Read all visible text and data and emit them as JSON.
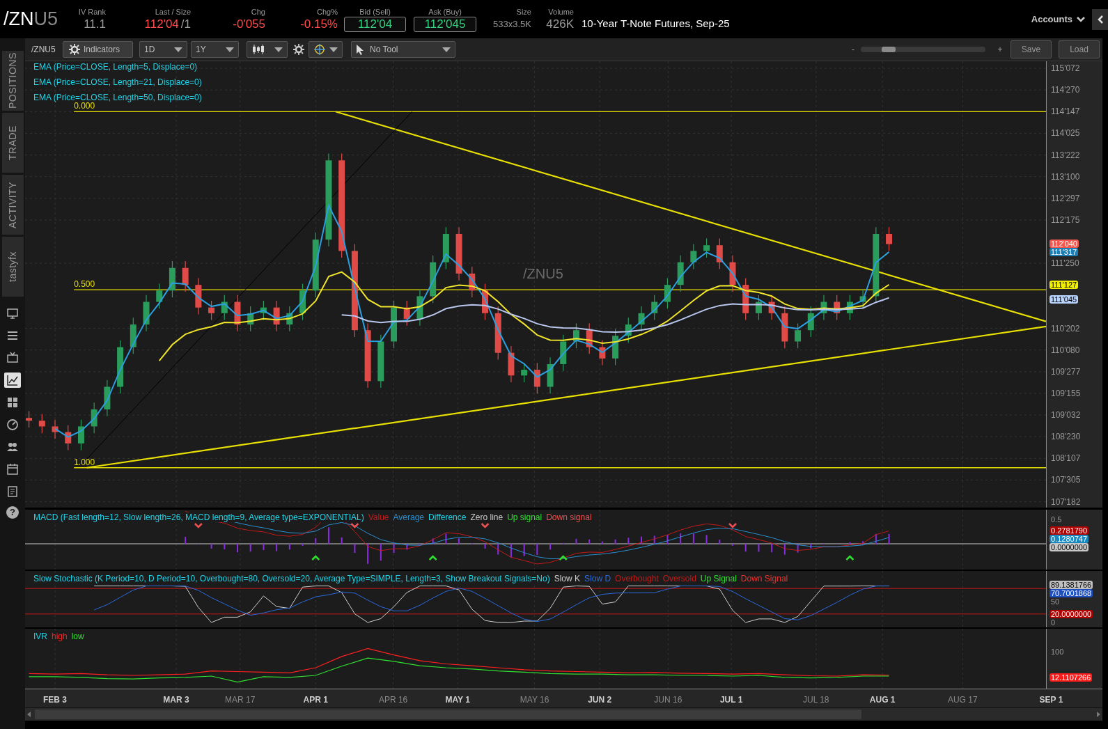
{
  "header": {
    "symbol_root": "/ZN",
    "symbol_month": "U5",
    "description": "10-Year T-Note Futures, Sep-25",
    "accounts": "Accounts"
  },
  "quote": [
    {
      "label": "IV Rank",
      "value": "11.1",
      "color": "#9a9a9a",
      "boxed": false
    },
    {
      "label": "Last / Size",
      "value": "112'04",
      "size": "/1",
      "color": "#ff4a4a",
      "boxed": false
    },
    {
      "label": "Chg",
      "value": "-0'055",
      "color": "#ff4a4a",
      "boxed": false
    },
    {
      "label": "Chg%",
      "value": "-0.15%",
      "color": "#ff4a4a",
      "boxed": false
    },
    {
      "label": "Bid (Sell)",
      "value": "112'04",
      "color": "#35d07f",
      "boxed": true
    },
    {
      "label": "Ask (Buy)",
      "value": "112'045",
      "color": "#35d07f",
      "boxed": true
    },
    {
      "label": "Size",
      "value": "533x3.5K",
      "color": "#9a9a9a",
      "boxed": false
    },
    {
      "label": "Volume",
      "value": "426K",
      "color": "#9a9a9a",
      "boxed": false
    }
  ],
  "toolbar": {
    "symbol": "/ZNU5",
    "indicators": "Indicators",
    "aggregation": "1D",
    "period": "1Y",
    "tool": "No Tool",
    "zoom_slider": {
      "level": 0.19
    },
    "zoom_out": "-",
    "zoom_in": "+",
    "save": "Save",
    "load": "Load"
  },
  "sidebar": {
    "tabs": [
      "POSITIONS",
      "TRADE",
      "ACTIVITY",
      "tastyfx"
    ],
    "tools": [
      {
        "selected": false
      },
      {
        "selected": false
      },
      {
        "selected": false
      },
      {
        "selected": true
      },
      {
        "selected": false
      },
      {
        "selected": false
      },
      {
        "selected": false
      },
      {
        "selected": false
      },
      {
        "selected": false
      }
    ],
    "help": "?"
  },
  "price_chart": {
    "watermark": "/ZNU5",
    "legend": [
      {
        "text": "EMA (Price=CLOSE, Length=5, Displace=0)",
        "color": "#22d3e6"
      },
      {
        "text": "EMA (Price=CLOSE, Length=21, Displace=0)",
        "color": "#22d3e6"
      },
      {
        "text": "EMA (Price=CLOSE, Length=50, Displace=0)",
        "color": "#22d3e6"
      }
    ],
    "fib_labels": [
      "0.000",
      "0.500",
      "1.000"
    ],
    "axis_labels": [
      "115'072",
      "114'270",
      "114'147",
      "114'025",
      "113'222",
      "113'100",
      "112'297",
      "112'175",
      "111'250",
      "110'202",
      "110'080",
      "109'277",
      "109'155",
      "109'032",
      "108'230",
      "108'107",
      "107'305",
      "107'182"
    ],
    "price_tags": [
      {
        "label": "112'040",
        "color": "#f0584f"
      },
      {
        "label": "111'317",
        "color": "#1a7fb5"
      },
      {
        "label": "111'127",
        "color": "#f2ee00"
      },
      {
        "label": "111'045",
        "color": "#b9d3ff"
      }
    ]
  },
  "macd": {
    "legend": [
      {
        "text": "MACD (Fast length=12, Slow length=26, MACD length=9, Average type=EXPONENTIAL)",
        "color": "#22d3e6"
      },
      {
        "text": "Value",
        "color": "#c41a1a"
      },
      {
        "text": "Average",
        "color": "#2a8fd0"
      },
      {
        "text": "Difference",
        "color": "#22d3e6"
      },
      {
        "text": "Zero line",
        "color": "#c8c8c8"
      },
      {
        "text": "Up signal",
        "color": "#2ee02e"
      },
      {
        "text": "Down signal",
        "color": "#f05050"
      }
    ],
    "ticks": [
      "0.5"
    ],
    "tags": [
      {
        "label": "0.2781790",
        "color": "#b00000"
      },
      {
        "label": "0.1280747",
        "color": "#1a88c0"
      },
      {
        "label": "0.0000000",
        "color": "#c8c8c8"
      }
    ]
  },
  "stochastic": {
    "legend": [
      {
        "text": "Slow Stochastic (K Period=10, D Period=10, Overbought=80, Oversold=20, Average Type=SIMPLE, Length=3, Show Breakout Signals=No)",
        "color": "#22d3e6"
      },
      {
        "text": "Slow K",
        "color": "#d0d0d0"
      },
      {
        "text": "Slow D",
        "color": "#2a6ae0"
      },
      {
        "text": "Overbought",
        "color": "#c41a1a"
      },
      {
        "text": "Oversold",
        "color": "#c41a1a"
      },
      {
        "text": "Up Signal",
        "color": "#2ee02e"
      },
      {
        "text": "Down Signal",
        "color": "#f03030"
      }
    ],
    "ticks": [
      "50",
      "0"
    ],
    "tags": [
      {
        "label": "89.1381766",
        "color": "#c0c0c0"
      },
      {
        "label": "70.7001868",
        "color": "#1e4fc0"
      },
      {
        "label": "20.0000000",
        "color": "#b00000"
      }
    ]
  },
  "ivr": {
    "legend": [
      {
        "text": "IVR",
        "color": "#22d3e6"
      },
      {
        "text": "high",
        "color": "#ff2020"
      },
      {
        "text": "low",
        "color": "#30e030"
      }
    ],
    "ticks": [
      "100"
    ],
    "tags": [
      {
        "label": "12.1107266",
        "color": "#ff1a1a"
      }
    ]
  },
  "date_axis": [
    {
      "label": "FEB 3",
      "bold": true
    },
    {
      "label": "MAR 3",
      "bold": true
    },
    {
      "label": "MAR 17",
      "bold": false
    },
    {
      "label": "APR 1",
      "bold": true
    },
    {
      "label": "APR 16",
      "bold": false
    },
    {
      "label": "MAY 1",
      "bold": true
    },
    {
      "label": "MAY 16",
      "bold": false
    },
    {
      "label": "JUN 2",
      "bold": true
    },
    {
      "label": "JUN 16",
      "bold": false
    },
    {
      "label": "JUL 1",
      "bold": true
    },
    {
      "label": "JUL 18",
      "bold": false
    },
    {
      "label": "AUG 1",
      "bold": true
    },
    {
      "label": "AUG 17",
      "bold": false
    },
    {
      "label": "SEP 1",
      "bold": true
    }
  ]
}
